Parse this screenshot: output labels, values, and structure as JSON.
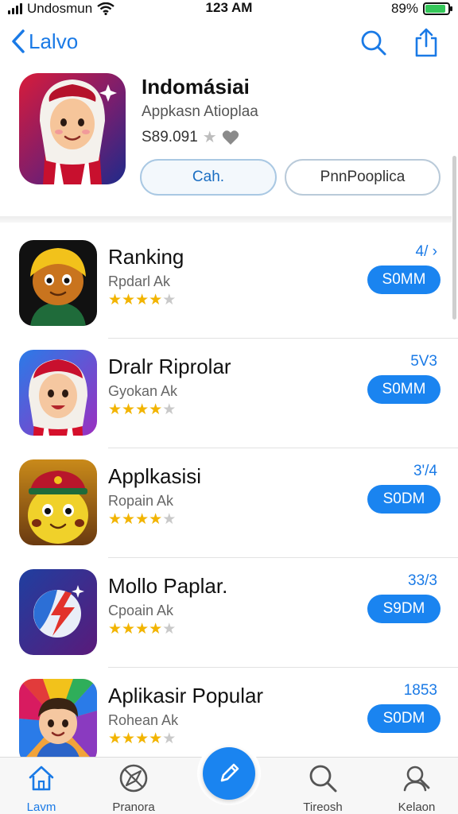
{
  "status_bar": {
    "carrier": "Undosmun",
    "time": "123 AM",
    "battery": "89%",
    "battery_level": 0.89
  },
  "nav": {
    "back_label": "Lalvo",
    "icons": [
      "search-icon",
      "share-icon"
    ]
  },
  "header_app": {
    "title": "Indomásiai",
    "subtitle": "Appkasn Atioplaa",
    "meta": "S89.091",
    "primary_button": "Cah.",
    "secondary_button": "PnnPooplica"
  },
  "apps": [
    {
      "title": "Ranking",
      "subtitle": "Rpdarl Ak",
      "count": "4/ ›",
      "button": "S0MM",
      "rating": 4
    },
    {
      "title": "Dralr Riprolar",
      "subtitle": "Gyokan Ak",
      "count": "5V3",
      "button": "S0MM",
      "rating": 4
    },
    {
      "title": "Applkasisi",
      "subtitle": "Ropain Ak",
      "count": "3'/4",
      "button": "S0DM",
      "rating": 4
    },
    {
      "title": "Mollo Paplar.",
      "subtitle": "Cpoain Ak",
      "count": "33/3",
      "button": "S9DM",
      "rating": 4
    },
    {
      "title": "Aplikasir Popular",
      "subtitle": "Rohean Ak",
      "count": "1853",
      "button": "S0DM",
      "rating": 4
    }
  ],
  "tabs": [
    {
      "label": "Lavm",
      "icon": "home-icon"
    },
    {
      "label": "Pranora",
      "icon": "compass-icon"
    },
    {
      "label": "Tireosh",
      "icon": "search-icon"
    },
    {
      "label": "Kelaon",
      "icon": "profile-icon"
    }
  ],
  "colors": {
    "accent": "#1a84f0",
    "star": "#f2b400",
    "battery": "#34c759"
  }
}
